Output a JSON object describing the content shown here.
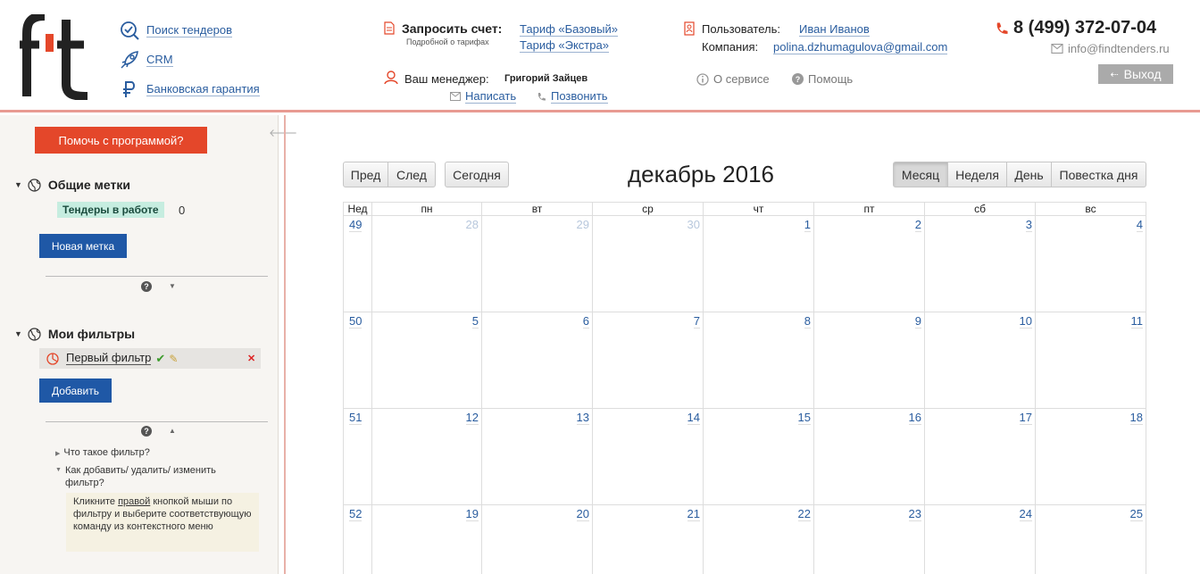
{
  "header": {
    "nav": [
      {
        "label": "Поиск тендеров",
        "icon": "search-check-icon"
      },
      {
        "label": "CRM",
        "icon": "rocket-icon"
      },
      {
        "label": "Банковская гарантия",
        "icon": "ruble-icon"
      }
    ],
    "invoice_label": "Запросить счет:",
    "tariff_hint": "Подробной о тарифах",
    "tariffs": [
      "Тариф «Базовый»",
      "Тариф «Экстра»"
    ],
    "manager_label": "Ваш менеджер:",
    "manager_name": "Григорий Зайцев",
    "write_label": "Написать",
    "call_label": "Позвонить",
    "user_label": "Пользователь:",
    "user_name": "Иван Иванов",
    "company_label": "Компания:",
    "company_value": "polina.dzhumagulova@gmail.com",
    "about_label": "О сервисе",
    "help_label": "Помощь",
    "phone": "8 (499) 372-07-04",
    "email": "info@findtenders.ru",
    "logout_label": "Выход",
    "accent_color": "#e4472a",
    "primary_color": "#1f58a6"
  },
  "sidebar": {
    "help_button": "Помочь с программой?",
    "tags_section": {
      "title": "Общие метки",
      "tag_label": "Тендеры в работе",
      "tag_count": "0",
      "button": "Новая метка"
    },
    "filters_section": {
      "title": "Мои фильтры",
      "filter_name": "Первый фильтр",
      "button": "Добавить"
    },
    "faq": [
      "Что такое фильтр?",
      "Как добавить/ удалить/ изменить фильтр?"
    ],
    "faq_answer_pre": "Кликните ",
    "faq_answer_link": "правой",
    "faq_answer_post": " кнопкой мыши по фильтру и выберите соответствующую команду из контекстного меню"
  },
  "calendar": {
    "prev_label": "Пред",
    "next_label": "След",
    "today_label": "Сегодня",
    "title": "декабрь 2016",
    "views": [
      "Месяц",
      "Неделя",
      "День",
      "Повестка дня"
    ],
    "active_view": "Месяц",
    "week_header": "Нед",
    "day_headers": [
      "пн",
      "вт",
      "ср",
      "чт",
      "пт",
      "сб",
      "вс"
    ],
    "weeks": [
      {
        "num": "49",
        "days": [
          {
            "d": "28",
            "other": true
          },
          {
            "d": "29",
            "other": true
          },
          {
            "d": "30",
            "other": true
          },
          {
            "d": "1"
          },
          {
            "d": "2"
          },
          {
            "d": "3"
          },
          {
            "d": "4"
          }
        ]
      },
      {
        "num": "50",
        "days": [
          {
            "d": "5"
          },
          {
            "d": "6"
          },
          {
            "d": "7"
          },
          {
            "d": "8"
          },
          {
            "d": "9"
          },
          {
            "d": "10"
          },
          {
            "d": "11"
          }
        ]
      },
      {
        "num": "51",
        "days": [
          {
            "d": "12"
          },
          {
            "d": "13"
          },
          {
            "d": "14"
          },
          {
            "d": "15"
          },
          {
            "d": "16"
          },
          {
            "d": "17"
          },
          {
            "d": "18"
          }
        ]
      },
      {
        "num": "52",
        "days": [
          {
            "d": "19"
          },
          {
            "d": "20"
          },
          {
            "d": "21"
          },
          {
            "d": "22"
          },
          {
            "d": "23"
          },
          {
            "d": "24"
          },
          {
            "d": "25"
          }
        ]
      }
    ]
  }
}
